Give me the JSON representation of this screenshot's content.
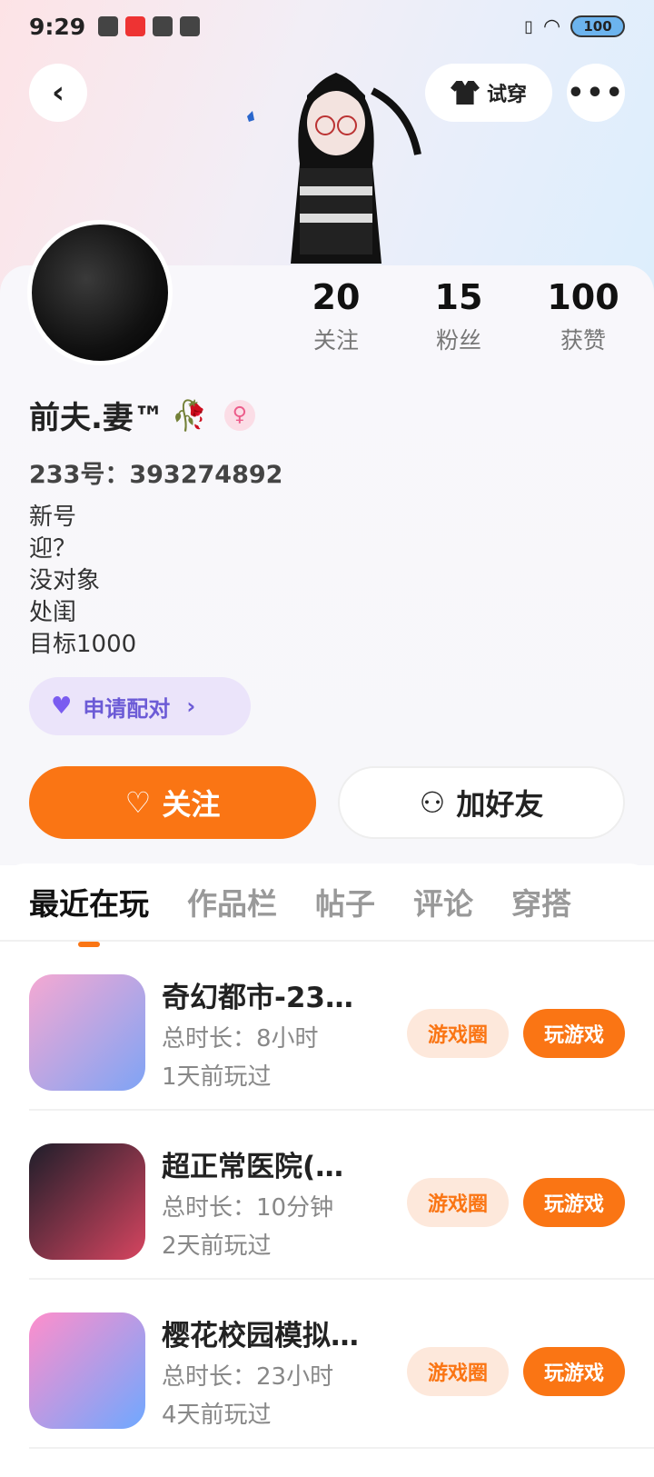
{
  "status_bar": {
    "time": "9:29",
    "battery": "100"
  },
  "header": {
    "tryon_label": "试穿",
    "more_label": "•••",
    "back_label": "‹"
  },
  "profile": {
    "stats": [
      {
        "value": "20",
        "label": "关注"
      },
      {
        "value": "15",
        "label": "粉丝"
      },
      {
        "value": "100",
        "label": "获赞"
      }
    ],
    "nickname": "前夫.妻™",
    "uid": "233号：393274892",
    "bio": [
      "新号",
      "迎？",
      "没对象",
      "处闺",
      "目标1000"
    ],
    "pair_label": "申请配对",
    "follow_label": "关注",
    "addfriend_label": "加好友"
  },
  "tabs": [
    "最近在玩",
    "作品栏",
    "帖子",
    "评论",
    "穿搭"
  ],
  "games": [
    {
      "title": "奇幻都市-23…",
      "duration": "总时长：8小时",
      "last_played": "1天前玩过",
      "circle_label": "游戏圈",
      "play_label": "玩游戏"
    },
    {
      "title": "超正常医院(…",
      "duration": "总时长：10分钟",
      "last_played": "2天前玩过",
      "circle_label": "游戏圈",
      "play_label": "玩游戏"
    },
    {
      "title": "樱花校园模拟…",
      "duration": "总时长：23小时",
      "last_played": "4天前玩过",
      "circle_label": "游戏圈",
      "play_label": "玩游戏"
    }
  ],
  "colors": {
    "accent": "#fa7514",
    "pair_purple": "#6c5bd6"
  }
}
